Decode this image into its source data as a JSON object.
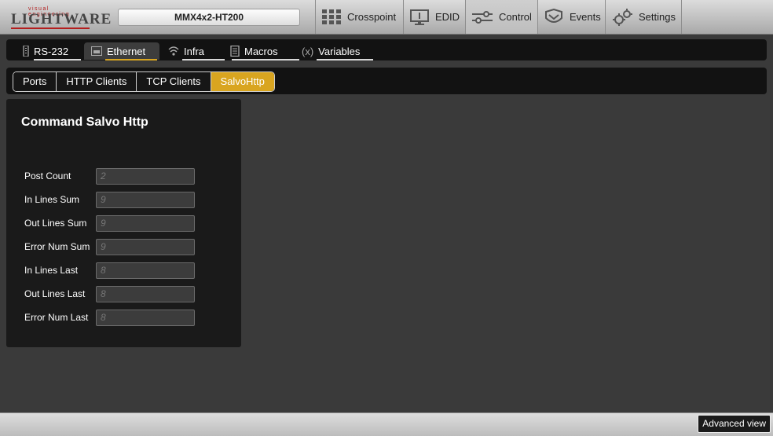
{
  "brand": {
    "tagline": "visual engineering",
    "name": "LIGHTWARE",
    "accent": "#b41e1e"
  },
  "device": {
    "name": "MMX4x2-HT200"
  },
  "nav": [
    {
      "label": "Crosspoint",
      "icon": "crosspoint-grid-icon"
    },
    {
      "label": "EDID",
      "icon": "monitor-icon"
    },
    {
      "label": "Control",
      "icon": "sliders-icon",
      "active": true
    },
    {
      "label": "Events",
      "icon": "events-icon"
    },
    {
      "label": "Settings",
      "icon": "gears-icon"
    }
  ],
  "tabs": [
    {
      "label": "RS-232",
      "icon": "serial-port-icon"
    },
    {
      "label": "Ethernet",
      "icon": "ethernet-icon",
      "active": true
    },
    {
      "label": "Infra",
      "icon": "infrared-icon"
    },
    {
      "label": "Macros",
      "icon": "macros-icon"
    },
    {
      "label": "Variables",
      "icon": "variables-icon",
      "icon_text": "(x)"
    }
  ],
  "subtabs": [
    {
      "label": "Ports"
    },
    {
      "label": "HTTP Clients"
    },
    {
      "label": "TCP Clients"
    },
    {
      "label": "SalvoHttp",
      "active": true
    }
  ],
  "panel": {
    "title": "Command Salvo Http",
    "fields": [
      {
        "label": "Post Count",
        "value": "2"
      },
      {
        "label": "In Lines Sum",
        "value": "9"
      },
      {
        "label": "Out Lines Sum",
        "value": "9"
      },
      {
        "label": "Error Num Sum",
        "value": "9"
      },
      {
        "label": "In Lines Last",
        "value": "8"
      },
      {
        "label": "Out Lines Last",
        "value": "8"
      },
      {
        "label": "Error Num Last",
        "value": "8"
      }
    ]
  },
  "footer": {
    "advanced_view_label": "Advanced view"
  },
  "colors": {
    "accent": "#d9a520",
    "background": "#3a3a3a",
    "panel": "#1a1a1a"
  }
}
